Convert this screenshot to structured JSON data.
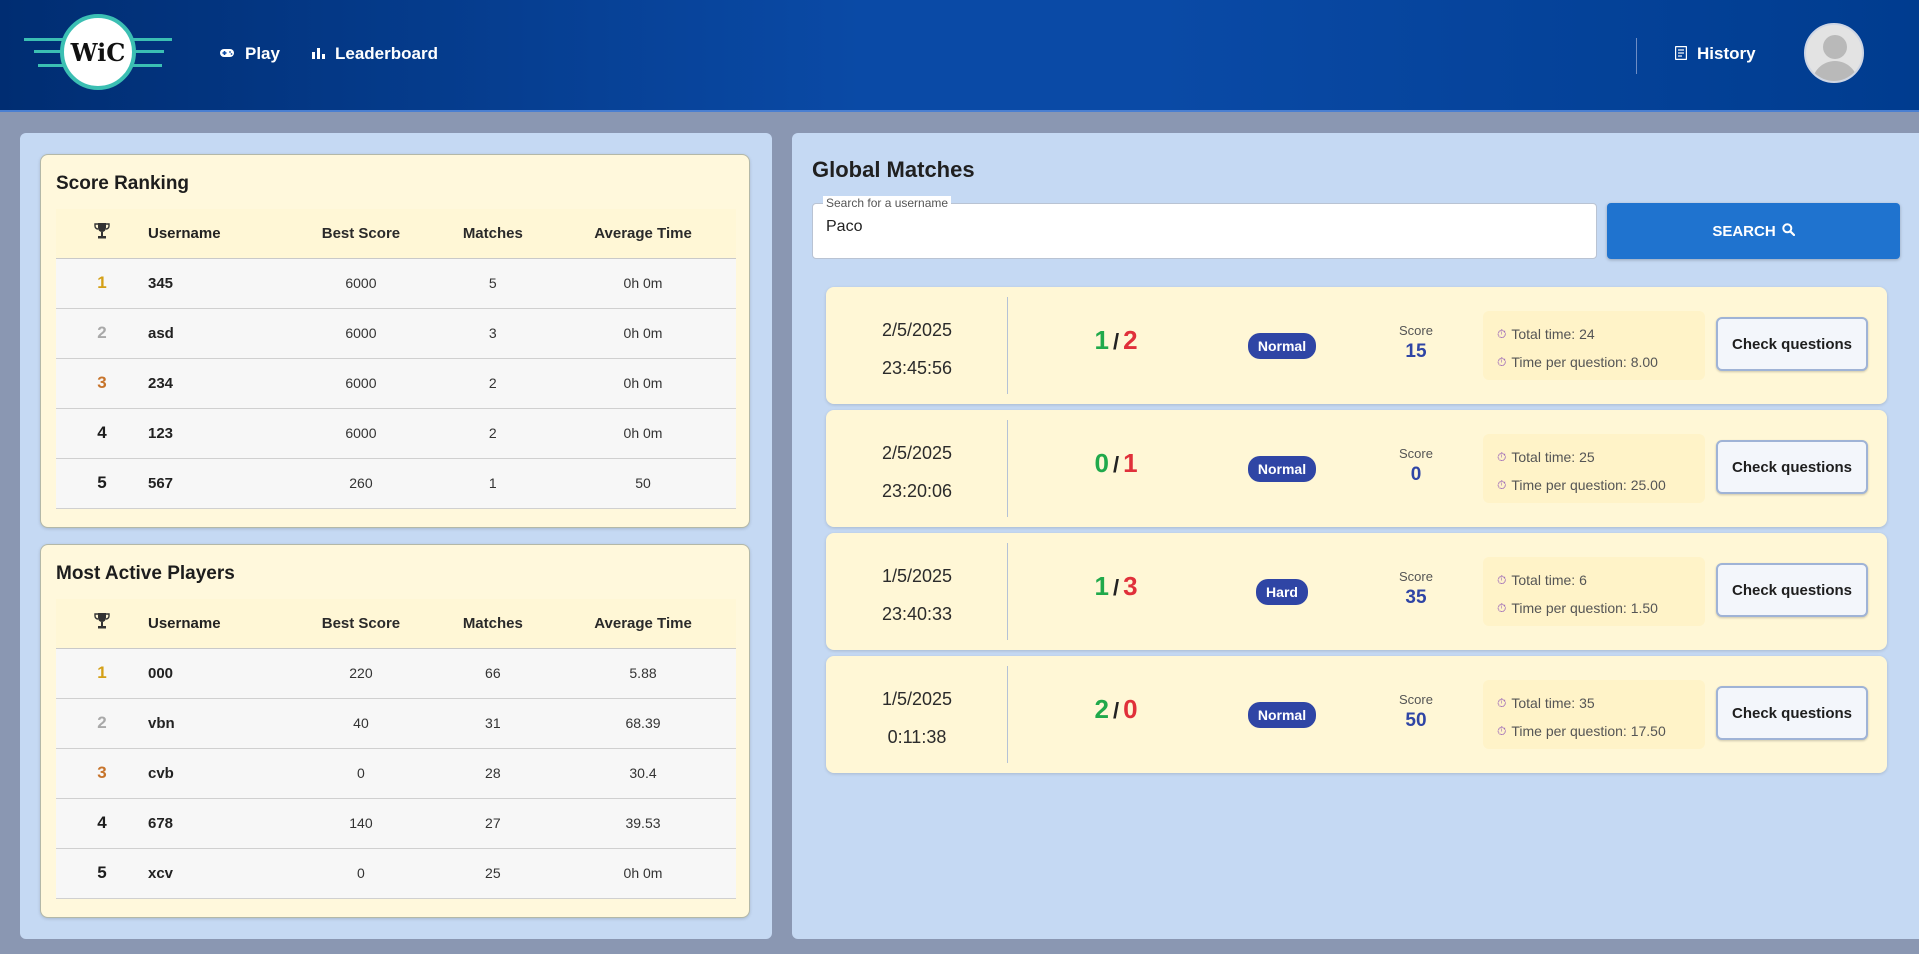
{
  "header": {
    "logo_text": "WiC",
    "nav": [
      {
        "label": "Play",
        "icon": "gamepad-icon"
      },
      {
        "label": "Leaderboard",
        "icon": "bar-chart-icon"
      }
    ],
    "history_label": "History"
  },
  "score_ranking": {
    "title": "Score Ranking",
    "columns": [
      "Username",
      "Best Score",
      "Matches",
      "Average Time"
    ],
    "rows": [
      {
        "pos": "1",
        "username": "345",
        "best_score": "6000",
        "matches": "5",
        "avg_time": "0h 0m"
      },
      {
        "pos": "2",
        "username": "asd",
        "best_score": "6000",
        "matches": "3",
        "avg_time": "0h 0m"
      },
      {
        "pos": "3",
        "username": "234",
        "best_score": "6000",
        "matches": "2",
        "avg_time": "0h 0m"
      },
      {
        "pos": "4",
        "username": "123",
        "best_score": "6000",
        "matches": "2",
        "avg_time": "0h 0m"
      },
      {
        "pos": "5",
        "username": "567",
        "best_score": "260",
        "matches": "1",
        "avg_time": "50"
      }
    ]
  },
  "most_active": {
    "title": "Most Active Players",
    "columns": [
      "Username",
      "Best Score",
      "Matches",
      "Average Time"
    ],
    "rows": [
      {
        "pos": "1",
        "username": "000",
        "best_score": "220",
        "matches": "66",
        "avg_time": "5.88"
      },
      {
        "pos": "2",
        "username": "vbn",
        "best_score": "40",
        "matches": "31",
        "avg_time": "68.39"
      },
      {
        "pos": "3",
        "username": "cvb",
        "best_score": "0",
        "matches": "28",
        "avg_time": "30.4"
      },
      {
        "pos": "4",
        "username": "678",
        "best_score": "140",
        "matches": "27",
        "avg_time": "39.53"
      },
      {
        "pos": "5",
        "username": "xcv",
        "best_score": "0",
        "matches": "25",
        "avg_time": "0h 0m"
      }
    ]
  },
  "global_matches": {
    "title": "Global Matches",
    "search": {
      "label": "Search for a username",
      "value": "Paco",
      "button_label": "SEARCH"
    },
    "check_label": "Check questions",
    "score_label": "Score",
    "matches": [
      {
        "date": "2/5/2025",
        "time": "23:45:56",
        "correct": "1",
        "total": "2",
        "difficulty": "Normal",
        "score": "15",
        "total_time": "Total time: 24",
        "time_per_q": "Time per question: 8.00"
      },
      {
        "date": "2/5/2025",
        "time": "23:20:06",
        "correct": "0",
        "total": "1",
        "difficulty": "Normal",
        "score": "0",
        "total_time": "Total time: 25",
        "time_per_q": "Time per question: 25.00"
      },
      {
        "date": "1/5/2025",
        "time": "23:40:33",
        "correct": "1",
        "total": "3",
        "difficulty": "Hard",
        "score": "35",
        "total_time": "Total time: 6",
        "time_per_q": "Time per question: 1.50"
      },
      {
        "date": "1/5/2025",
        "time": "0:11:38",
        "correct": "2",
        "total": "0",
        "difficulty": "Normal",
        "score": "50",
        "total_time": "Total time: 35",
        "time_per_q": "Time per question: 17.50"
      }
    ]
  },
  "colors": {
    "correct": "#20a94b",
    "wrong": "#e0303a",
    "accent": "#2f45a5",
    "gold": "#d4a017",
    "silver": "#a9a9a9",
    "bronze": "#c7742b"
  }
}
